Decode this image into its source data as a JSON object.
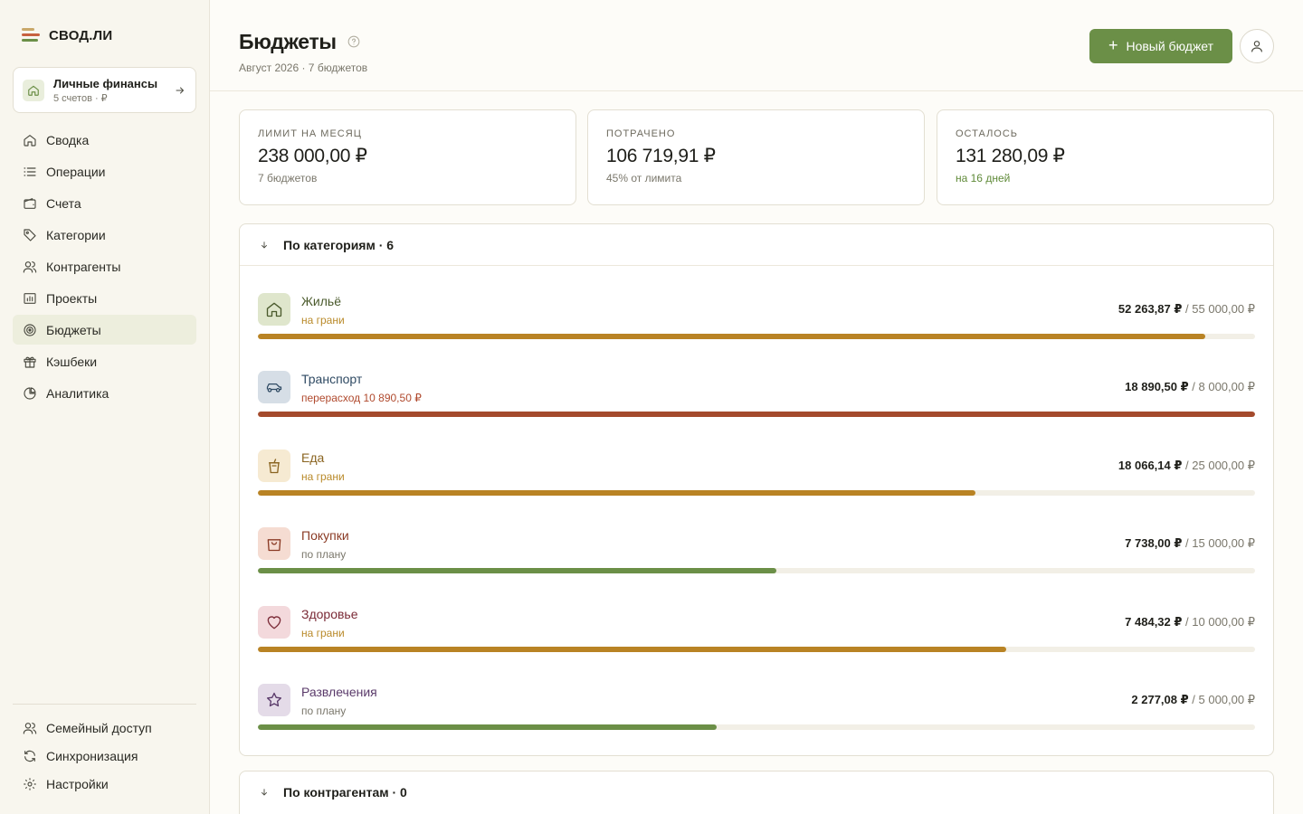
{
  "brand": {
    "name": "СВОД.ЛИ"
  },
  "workspace": {
    "title": "Личные финансы",
    "subtitle": "5 счетов · ₽"
  },
  "nav": [
    {
      "label": "Сводка",
      "icon": "home-icon"
    },
    {
      "label": "Операции",
      "icon": "list-icon"
    },
    {
      "label": "Счета",
      "icon": "wallet-icon"
    },
    {
      "label": "Категории",
      "icon": "tag-icon"
    },
    {
      "label": "Контрагенты",
      "icon": "users-icon"
    },
    {
      "label": "Проекты",
      "icon": "chart-icon"
    },
    {
      "label": "Бюджеты",
      "icon": "target-icon",
      "active": true
    },
    {
      "label": "Кэшбеки",
      "icon": "gift-icon"
    },
    {
      "label": "Аналитика",
      "icon": "pie-icon"
    }
  ],
  "nav_bottom": [
    {
      "label": "Семейный доступ",
      "icon": "family-icon"
    },
    {
      "label": "Синхронизация",
      "icon": "sync-icon"
    },
    {
      "label": "Настройки",
      "icon": "gear-icon"
    }
  ],
  "header": {
    "title": "Бюджеты",
    "subtitle": "Август 2026 · 7 бюджетов",
    "new_button": "Новый бюджет"
  },
  "stats": [
    {
      "label": "ЛИМИТ НА МЕСЯЦ",
      "value": "238 000,00 ₽",
      "note": "7 бюджетов"
    },
    {
      "label": "ПОТРАЧЕНО",
      "value": "106 719,91 ₽",
      "note": "45% от лимита"
    },
    {
      "label": "ОСТАЛОСЬ",
      "value": "131 280,09 ₽",
      "note": "на 16 дней"
    }
  ],
  "categories_panel": {
    "title": "По категориям · 6",
    "rows": [
      {
        "name": "Жильё",
        "status": "на грани",
        "spent": "52 263,87 ₽",
        "limit": "/ 55 000,00 ₽",
        "progress": 0.95,
        "name_color": "#4a5a2c",
        "status_color": "#b98a2a",
        "bar_color": "#b98324",
        "icon": "house-icon",
        "icon_bg": "#dfe6cc"
      },
      {
        "name": "Транспорт",
        "status": "перерасход 10 890,50 ₽",
        "spent": "18 890,50 ₽",
        "limit": "/ 8 000,00 ₽",
        "progress": 1.0,
        "name_color": "#2f4a63",
        "status_color": "#b04a2e",
        "bar_color": "#a44a2c",
        "icon": "car-icon",
        "icon_bg": "#d6dee6"
      },
      {
        "name": "Еда",
        "status": "на грани",
        "spent": "18 066,14 ₽",
        "limit": "/ 25 000,00 ₽",
        "progress": 0.72,
        "name_color": "#8a6420",
        "status_color": "#b98a2a",
        "bar_color": "#b98324",
        "icon": "cup-icon",
        "icon_bg": "#f6ead2"
      },
      {
        "name": "Покупки",
        "status": "по плану",
        "spent": "7 738,00 ₽",
        "limit": "/ 15 000,00 ₽",
        "progress": 0.52,
        "name_color": "#8a3a24",
        "status_color": "#7a776b",
        "bar_color": "#6b8f47",
        "icon": "bag-icon",
        "icon_bg": "#f5dcd2"
      },
      {
        "name": "Здоровье",
        "status": "на грани",
        "spent": "7 484,32 ₽",
        "limit": "/ 10 000,00 ₽",
        "progress": 0.75,
        "name_color": "#7a2a36",
        "status_color": "#b98a2a",
        "bar_color": "#b98324",
        "icon": "heart-icon",
        "icon_bg": "#f3d9dc"
      },
      {
        "name": "Развлечения",
        "status": "по плану",
        "spent": "2 277,08 ₽",
        "limit": "/ 5 000,00 ₽",
        "progress": 0.46,
        "name_color": "#5a3a6a",
        "status_color": "#7a776b",
        "bar_color": "#6b8f47",
        "icon": "star-icon",
        "icon_bg": "#e4dbe8"
      }
    ]
  },
  "counterparties_panel": {
    "title": "По контрагентам · 0"
  }
}
